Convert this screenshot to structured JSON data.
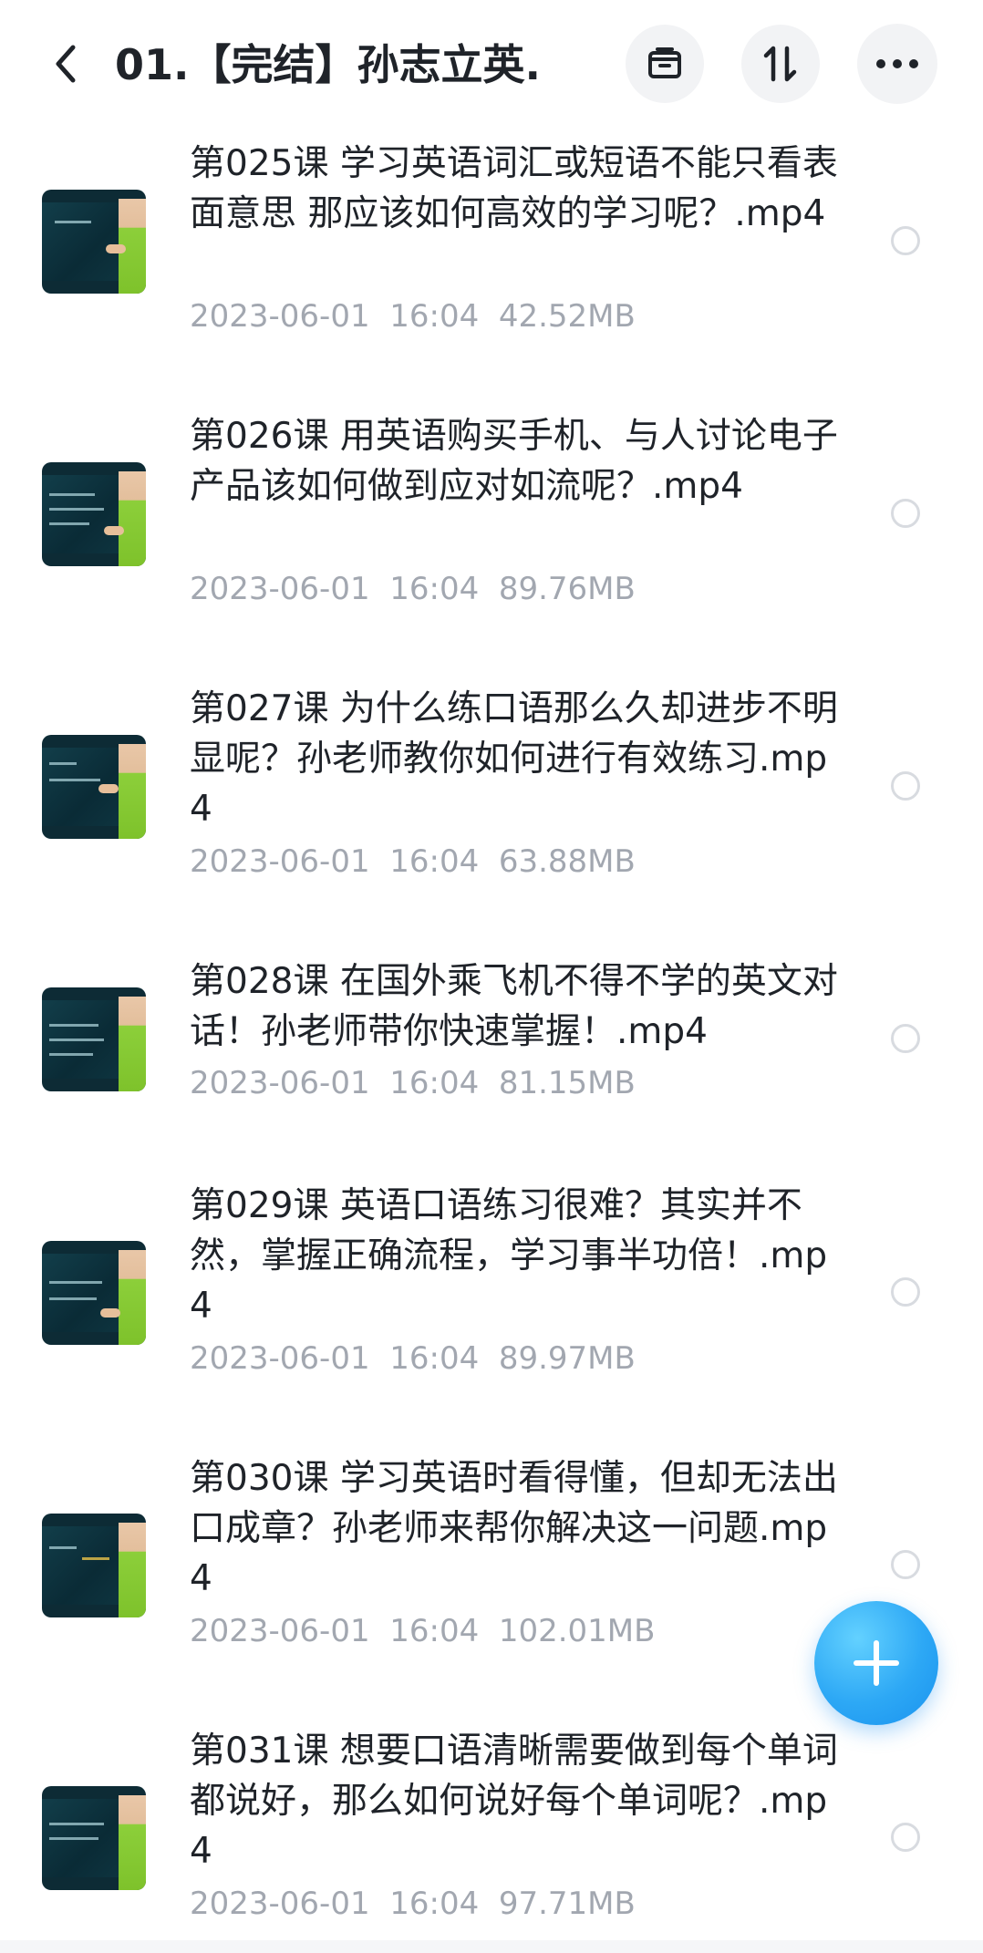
{
  "header": {
    "title": "01.【完结】孙志立英...",
    "icons": {
      "back": "chevron-left-icon",
      "archive": "archive-box-icon",
      "sort": "sort-arrows-icon",
      "more": "more-dots-icon"
    }
  },
  "files": [
    {
      "name": "第025课 学习英语词汇或短语不能只看表面意思 那应该如何高效的学习呢？.mp4",
      "date": "2023-06-01",
      "time": "16:04",
      "size": "42.52MB",
      "selected": false
    },
    {
      "name": "第026课 用英语购买手机、与人讨论电子产品该如何做到应对如流呢？.mp4",
      "date": "2023-06-01",
      "time": "16:04",
      "size": "89.76MB",
      "selected": false
    },
    {
      "name": "第027课 为什么练口语那么久却进步不明显呢？孙老师教你如何进行有效练习.mp4",
      "date": "2023-06-01",
      "time": "16:04",
      "size": "63.88MB",
      "selected": false
    },
    {
      "name": "第028课 在国外乘飞机不得不学的英文对话！孙老师带你快速掌握！.mp4",
      "date": "2023-06-01",
      "time": "16:04",
      "size": "81.15MB",
      "selected": false
    },
    {
      "name": "第029课 英语口语练习很难？其实并不然，掌握正确流程，学习事半功倍！.mp4",
      "date": "2023-06-01",
      "time": "16:04",
      "size": "89.97MB",
      "selected": false
    },
    {
      "name": "第030课 学习英语时看得懂，但却无法出口成章？孙老师来帮你解决这一问题.mp4",
      "date": "2023-06-01",
      "time": "16:04",
      "size": "102.01MB",
      "selected": false
    },
    {
      "name": "第031课 想要口语清晰需要做到每个单词都说好，那么如何说好每个单词呢？.mp4",
      "date": "2023-06-01",
      "time": "16:04",
      "size": "97.71MB",
      "selected": false
    }
  ],
  "fab": {
    "icon": "plus-icon"
  },
  "colors": {
    "accent": "#2da8f5",
    "text_primary": "#1f2329",
    "text_secondary": "#a2a7b0",
    "header_button_bg": "#f2f3f5"
  }
}
